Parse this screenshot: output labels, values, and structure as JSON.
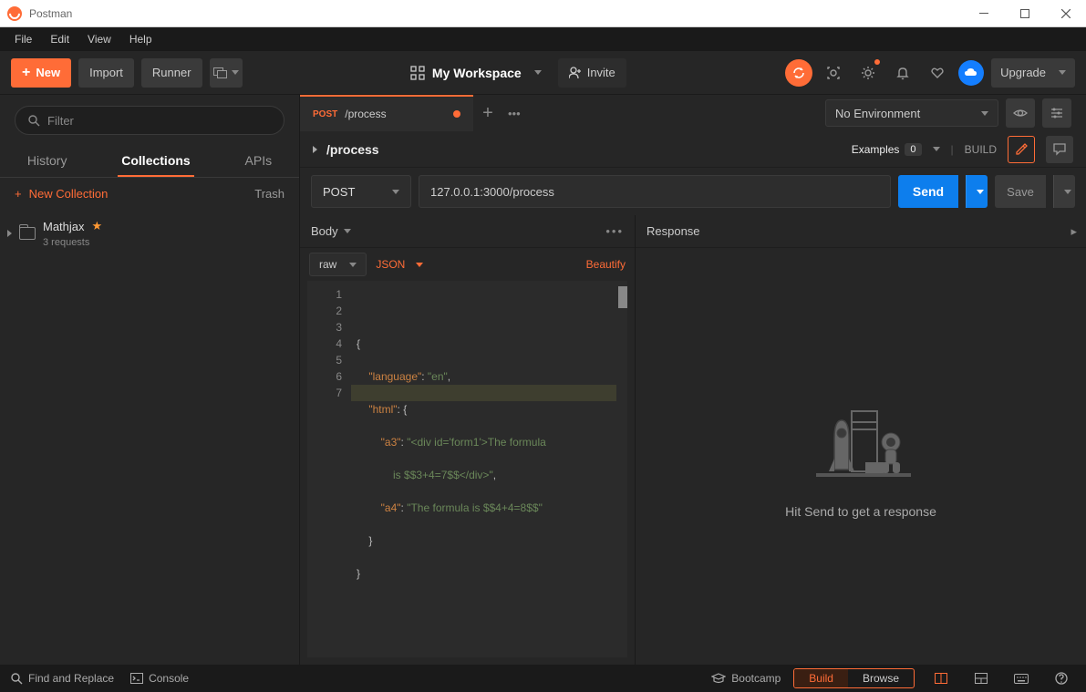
{
  "window": {
    "title": "Postman"
  },
  "menubar": [
    "File",
    "Edit",
    "View",
    "Help"
  ],
  "header": {
    "new": "New",
    "import": "Import",
    "runner": "Runner",
    "workspace": "My Workspace",
    "invite": "Invite",
    "upgrade": "Upgrade"
  },
  "sidebar": {
    "filter_placeholder": "Filter",
    "tabs": [
      "History",
      "Collections",
      "APIs"
    ],
    "active_tab": "Collections",
    "newCollection": "New Collection",
    "trash": "Trash",
    "collection": {
      "name": "Mathjax",
      "sub": "3 requests"
    }
  },
  "tabs": {
    "method": "POST",
    "title": "/process"
  },
  "env": {
    "label": "No Environment"
  },
  "request": {
    "name": "/process",
    "examples": "Examples",
    "exCount": "0",
    "build": "BUILD",
    "method": "POST",
    "url": "127.0.0.1:3000/process",
    "send": "Send",
    "save": "Save"
  },
  "bodyTab": {
    "label": "Body",
    "raw": "raw",
    "json": "JSON",
    "beautify": "Beautify"
  },
  "code": {
    "lines": [
      "1",
      "2",
      "3",
      "4",
      "",
      "5",
      "6",
      "7"
    ],
    "l1": "{",
    "l2_k": "\"language\"",
    "l2_v": "\"en\"",
    "l3_k": "\"html\"",
    "l4_k": "\"a3\"",
    "l4_v": "\"<div id='form1'>The formula",
    "l4_c": "is $$3+4=7$$</div>\"",
    "l5_k": "\"a4\"",
    "l5_v": "\"The formula is $$4+4=8$$\"",
    "l6": "    }",
    "l7": "}"
  },
  "response": {
    "label": "Response",
    "empty": "Hit Send to get a response"
  },
  "statusbar": {
    "find": "Find and Replace",
    "console": "Console",
    "bootcamp": "Bootcamp",
    "build": "Build",
    "browse": "Browse"
  }
}
